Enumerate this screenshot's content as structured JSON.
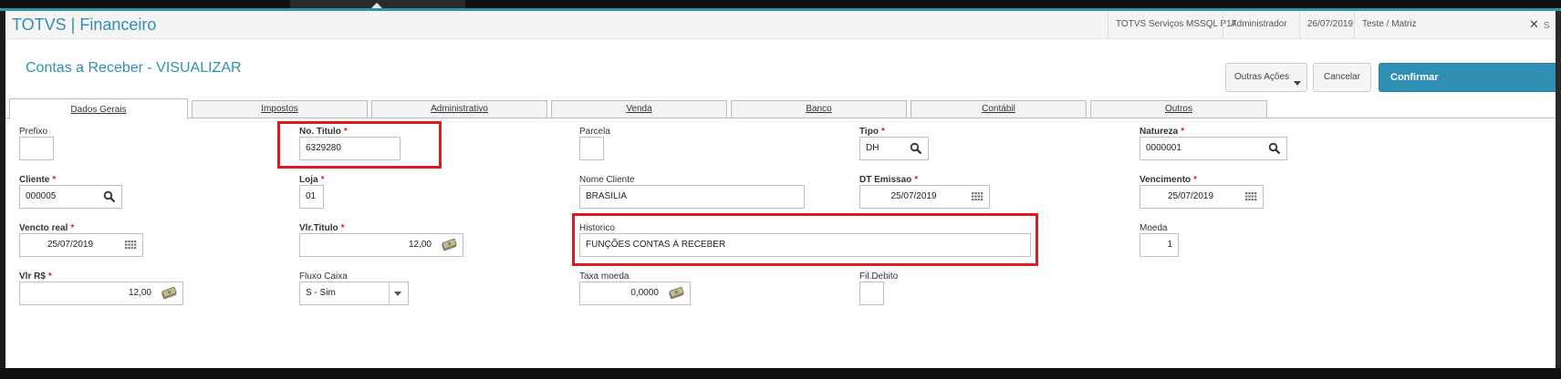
{
  "app": {
    "title": "TOTVS | Financeiro"
  },
  "titlebar": {
    "server": "TOTVS Serviços MSSQL P17",
    "user": "Administrador",
    "date": "26/07/2019",
    "company": "Teste / Matriz",
    "close_symbol": "✕",
    "close_label_partial": "S"
  },
  "page": {
    "title": "Contas a Receber - VISUALIZAR"
  },
  "actions": {
    "other": "Outras Ações",
    "cancel": "Cancelar",
    "confirm": "Confirmar"
  },
  "tabs": [
    {
      "label": "Dados Gerais",
      "active": true
    },
    {
      "label": "Impostos"
    },
    {
      "label": "Administrativo"
    },
    {
      "label": "Venda"
    },
    {
      "label": "Banco"
    },
    {
      "label": "Contábil"
    },
    {
      "label": "Outros"
    }
  ],
  "fields": {
    "prefixo": {
      "label": "Prefixo",
      "value": ""
    },
    "no_titulo": {
      "label": "No. Titulo",
      "value": "6329280",
      "required": true
    },
    "parcela": {
      "label": "Parcela",
      "value": ""
    },
    "tipo": {
      "label": "Tipo",
      "value": "DH",
      "required": true
    },
    "natureza": {
      "label": "Natureza",
      "value": "0000001",
      "required": true
    },
    "cliente": {
      "label": "Cliente",
      "value": "000005",
      "required": true
    },
    "loja": {
      "label": "Loja",
      "value": "01",
      "required": true
    },
    "nome_cliente": {
      "label": "Nome Cliente",
      "value": "BRASILIA"
    },
    "dt_emissao": {
      "label": "DT Emissao",
      "value": "25/07/2019",
      "required": true
    },
    "vencimento": {
      "label": "Vencimento",
      "value": "25/07/2019",
      "required": true
    },
    "vencto_real": {
      "label": "Vencto real",
      "value": "25/07/2019",
      "required": true
    },
    "vlr_titulo": {
      "label": "Vlr.Titulo",
      "value": "12,00",
      "required": true
    },
    "historico": {
      "label": "Historico",
      "value": "FUNÇÕES CONTAS À RECEBER"
    },
    "moeda": {
      "label": "Moeda",
      "value": "1"
    },
    "vlr_rs": {
      "label": "Vlr R$",
      "value": "12,00",
      "required": true
    },
    "fluxo_caixa": {
      "label": "Fluxo Caixa",
      "value": "S - Sim"
    },
    "taxa_moeda": {
      "label": "Taxa moeda",
      "value": "0,0000"
    },
    "fil_debito": {
      "label": "Fil.Debito",
      "value": ""
    }
  },
  "required_marker": "*",
  "icons": {
    "search": "magnifier-icon",
    "calendar": "calendar-icon",
    "money": "money-icon",
    "dropdown": "chevron-down-icon"
  },
  "colors": {
    "accent": "#2f8fb3",
    "required": "#d22222",
    "highlight": "#e0191f"
  }
}
